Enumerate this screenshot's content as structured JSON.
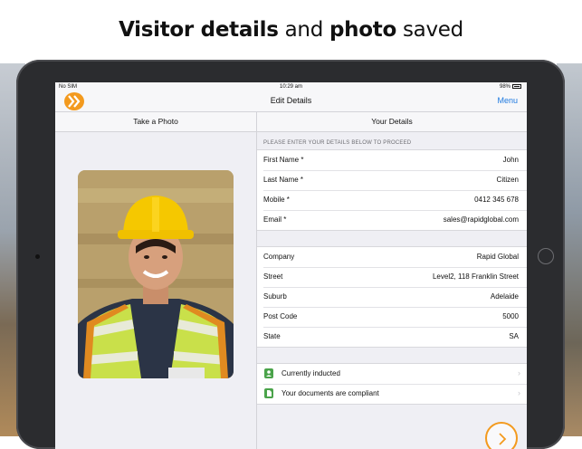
{
  "headline": {
    "bold1": "Visitor details",
    "light1": "and",
    "bold2": "photo",
    "light2": "saved"
  },
  "statusbar": {
    "carrier": "No SIM",
    "time": "10:29 am",
    "battery": "98%"
  },
  "navbar": {
    "title": "Edit Details",
    "menu": "Menu"
  },
  "left_pane": {
    "header": "Take a Photo"
  },
  "right_pane": {
    "header": "Your Details",
    "instruction": "PLEASE ENTER YOUR DETAILS BELOW TO PROCEED",
    "personal": [
      {
        "label": "First Name *",
        "value": "John"
      },
      {
        "label": "Last Name *",
        "value": "Citizen"
      },
      {
        "label": "Mobile *",
        "value": "0412 345 678"
      },
      {
        "label": "Email *",
        "value": "sales@rapidglobal.com"
      }
    ],
    "company": [
      {
        "label": "Company",
        "value": "Rapid Global"
      },
      {
        "label": "Street",
        "value": "Level2, 118 Franklin Street"
      },
      {
        "label": "Suburb",
        "value": "Adelaide"
      },
      {
        "label": "Post Code",
        "value": "5000"
      },
      {
        "label": "State",
        "value": "SA"
      }
    ],
    "status": [
      {
        "label": "Currently inducted",
        "icon": "person-icon"
      },
      {
        "label": "Your documents are compliant",
        "icon": "document-icon"
      }
    ]
  },
  "colors": {
    "accent": "#f39a1e",
    "link": "#1f7ae0",
    "status_green": "#4aa34a"
  }
}
